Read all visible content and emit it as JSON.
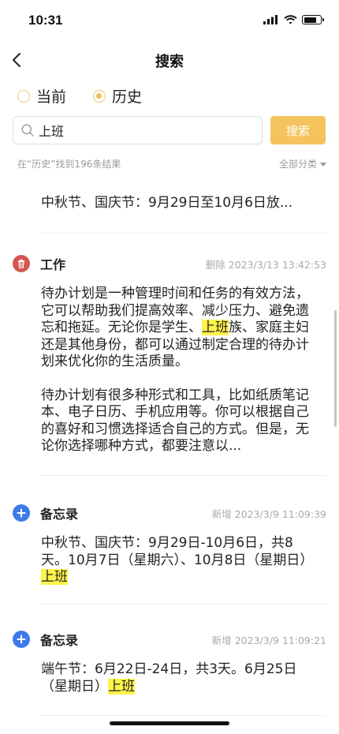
{
  "status_bar": {
    "time": "10:31"
  },
  "nav": {
    "title": "搜索"
  },
  "scope": {
    "current": "当前",
    "history": "历史",
    "selected": "history"
  },
  "search": {
    "value": "上班",
    "button": "搜索"
  },
  "summary": {
    "text": "在“历史”找到196条结果",
    "filter": "全部分类"
  },
  "items": [
    {
      "title": "",
      "meta": "",
      "body": [
        "中秋节、国庆节：9月29日至10月6日放..."
      ]
    },
    {
      "icon": "trash-icon",
      "title": "工作",
      "meta": "删除 2023/3/13 13:42:53",
      "p1": {
        "before": "待办计划是一种管理时间和任务的有效方法，它可以帮助我们提高效率、减少压力、避免遗忘和拖延。无论你是学生、",
        "highlight": "上班",
        "after": "族、家庭主妇还是其他身份，都可以通过制定合理的待办计划来优化你的生活质量。"
      },
      "p2": "待办计划有很多种形式和工具，比如纸质笔记本、电子日历、手机应用等。你可以根据自己的喜好和习惯选择适合自己的方式。但是，无论你选择哪种方式，都要注意以..."
    },
    {
      "icon": "plus-icon",
      "title": "备忘录",
      "meta": "新增 2023/3/9 11:09:39",
      "p1": {
        "before": "中秋节、国庆节：9月29日-10月6日，共8天。10月7日（星期六）、10月8日（星期日）",
        "highlight": "上班",
        "after": ""
      }
    },
    {
      "icon": "plus-icon",
      "title": "备忘录",
      "meta": "新增 2023/3/9 11:09:21",
      "p1": {
        "before": "端午节：6月22日-24日，共3天。6月25日（星期日）",
        "highlight": "上班",
        "after": ""
      }
    }
  ],
  "colors": {
    "accent": "#f4c35d",
    "highlight": "#fff34a",
    "delete": "#d4574f",
    "add": "#3f7be8"
  }
}
